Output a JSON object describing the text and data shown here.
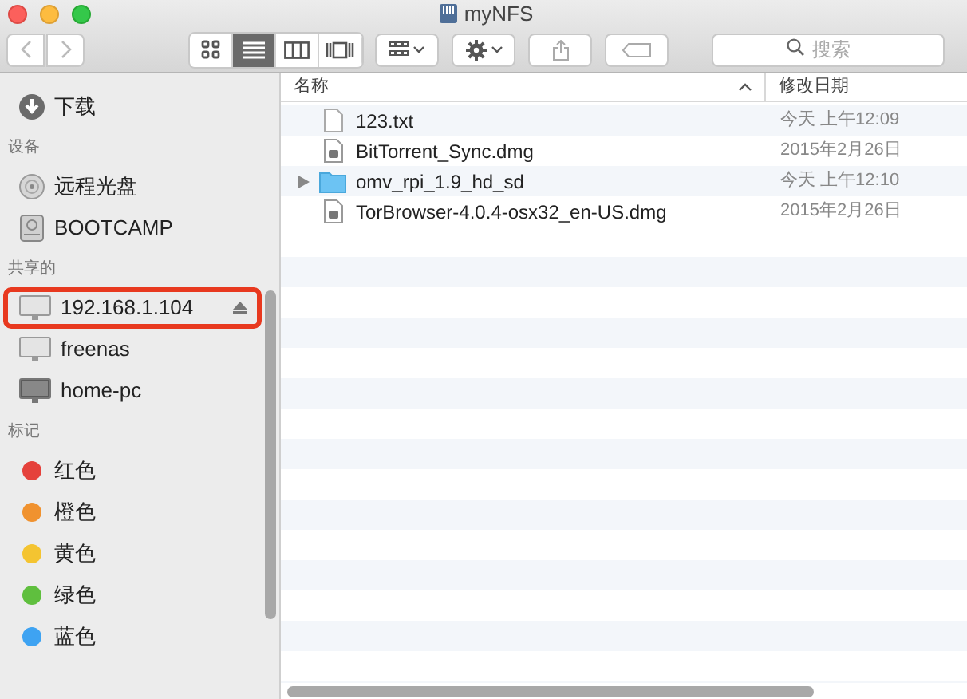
{
  "window": {
    "title": "myNFS"
  },
  "toolbar": {
    "view_modes": [
      {
        "kind": "icons",
        "selected": false
      },
      {
        "kind": "list",
        "selected": true
      },
      {
        "kind": "columns",
        "selected": false
      },
      {
        "kind": "coverflow",
        "selected": false
      }
    ],
    "search": {
      "placeholder": "搜索"
    }
  },
  "sidebar": {
    "sections": [
      {
        "items": [
          {
            "label": "下载",
            "kind": "download"
          }
        ]
      },
      {
        "title": "设备",
        "items": [
          {
            "label": "远程光盘",
            "kind": "disc"
          },
          {
            "label": "BOOTCAMP",
            "kind": "drive"
          }
        ]
      },
      {
        "title": "共享的",
        "items": [
          {
            "label": "192.168.1.104",
            "kind": "server",
            "eject": true,
            "highlighted": true
          },
          {
            "label": "freenas",
            "kind": "server",
            "eject": false,
            "highlighted": false
          },
          {
            "label": "home-pc",
            "kind": "pc",
            "eject": false,
            "highlighted": false
          }
        ]
      },
      {
        "title": "标记",
        "items": [
          {
            "label": "红色",
            "kind": "tag",
            "color": "#e5413b"
          },
          {
            "label": "橙色",
            "kind": "tag",
            "color": "#f0922f"
          },
          {
            "label": "黄色",
            "kind": "tag",
            "color": "#f4c431"
          },
          {
            "label": "绿色",
            "kind": "tag",
            "color": "#5fbf3e"
          },
          {
            "label": "蓝色",
            "kind": "tag",
            "color": "#3ea3f2"
          }
        ]
      }
    ]
  },
  "table": {
    "columns": [
      {
        "label": "名称",
        "sorted": true
      },
      {
        "label": "修改日期",
        "sorted": false
      }
    ],
    "rows": [
      {
        "name": "123.txt",
        "kind": "text",
        "date": "今天 上午12:09"
      },
      {
        "name": "BitTorrent_Sync.dmg",
        "kind": "dmg",
        "date": "2015年2月26日"
      },
      {
        "name": "omv_rpi_1.9_hd_sd",
        "kind": "folder",
        "date": "今天 上午12:10"
      },
      {
        "name": "TorBrowser-4.0.4-osx32_en-US.dmg",
        "kind": "dmg",
        "date": "2015年2月26日"
      }
    ]
  }
}
